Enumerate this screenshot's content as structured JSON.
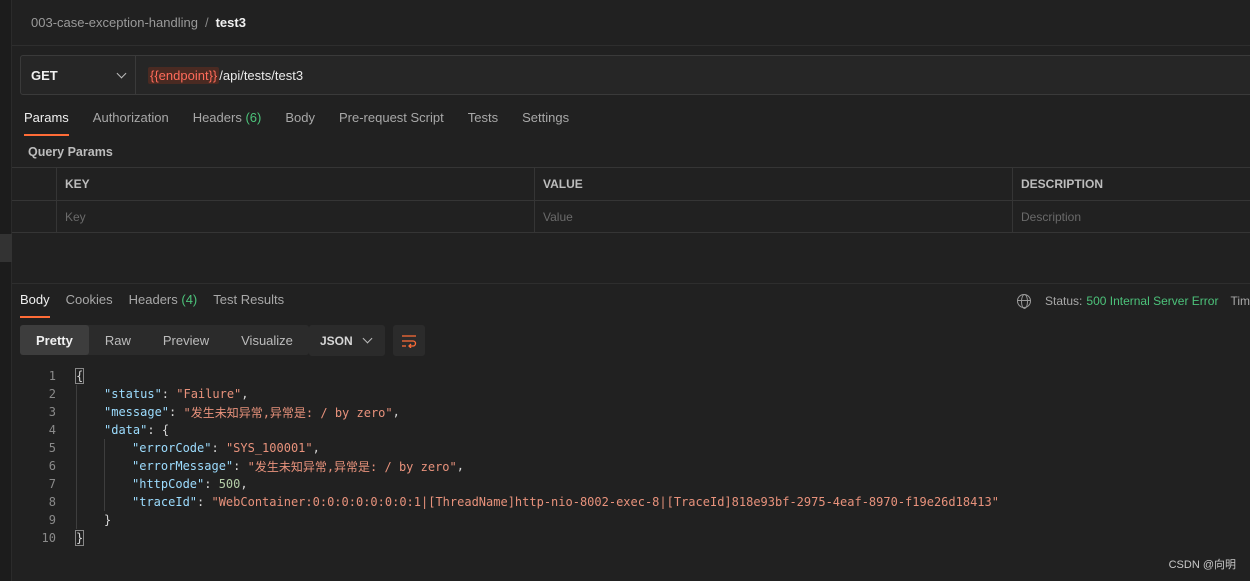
{
  "breadcrumb": {
    "parent": "003-case-exception-handling",
    "separator": "/",
    "current": "test3"
  },
  "request": {
    "method": "GET",
    "url_variable": "{{endpoint}}",
    "url_path": "/api/tests/test3"
  },
  "request_tabs": [
    {
      "label": "Params",
      "active": true
    },
    {
      "label": "Authorization"
    },
    {
      "label": "Headers",
      "count": "(6)"
    },
    {
      "label": "Body"
    },
    {
      "label": "Pre-request Script"
    },
    {
      "label": "Tests"
    },
    {
      "label": "Settings"
    }
  ],
  "query_params": {
    "title": "Query Params",
    "headers": [
      "KEY",
      "VALUE",
      "DESCRIPTION"
    ],
    "placeholders": [
      "Key",
      "Value",
      "Description"
    ]
  },
  "response_tabs": [
    {
      "label": "Body",
      "active": true
    },
    {
      "label": "Cookies"
    },
    {
      "label": "Headers",
      "count": "(4)"
    },
    {
      "label": "Test Results"
    }
  ],
  "status": {
    "label": "Status:",
    "value": "500 Internal Server Error",
    "time_label": "Tim"
  },
  "view_modes": [
    "Pretty",
    "Raw",
    "Preview",
    "Visualize"
  ],
  "format": "JSON",
  "code_lines": [
    {
      "n": "1",
      "text": "{"
    },
    {
      "n": "2",
      "key": "\"status\"",
      "val": "\"Failure\"",
      "tail": ","
    },
    {
      "n": "3",
      "key": "\"message\"",
      "val": "\"发生未知异常,异常是: / by zero\"",
      "tail": ","
    },
    {
      "n": "4",
      "key": "\"data\"",
      "val": "{"
    },
    {
      "n": "5",
      "key": "\"errorCode\"",
      "val": "\"SYS_100001\"",
      "tail": ","
    },
    {
      "n": "6",
      "key": "\"errorMessage\"",
      "val": "\"发生未知异常,异常是: / by zero\"",
      "tail": ","
    },
    {
      "n": "7",
      "key": "\"httpCode\"",
      "val": "500",
      "tail": ","
    },
    {
      "n": "8",
      "key": "\"traceId\"",
      "val": "\"WebContainer:0:0:0:0:0:0:0:1|[ThreadName]http-nio-8002-exec-8|[TraceId]818e93bf-2975-4eaf-8970-f19e26d18413\""
    },
    {
      "n": "9",
      "text": "}"
    },
    {
      "n": "10",
      "text": "}"
    }
  ],
  "watermark": "CSDN @向明"
}
